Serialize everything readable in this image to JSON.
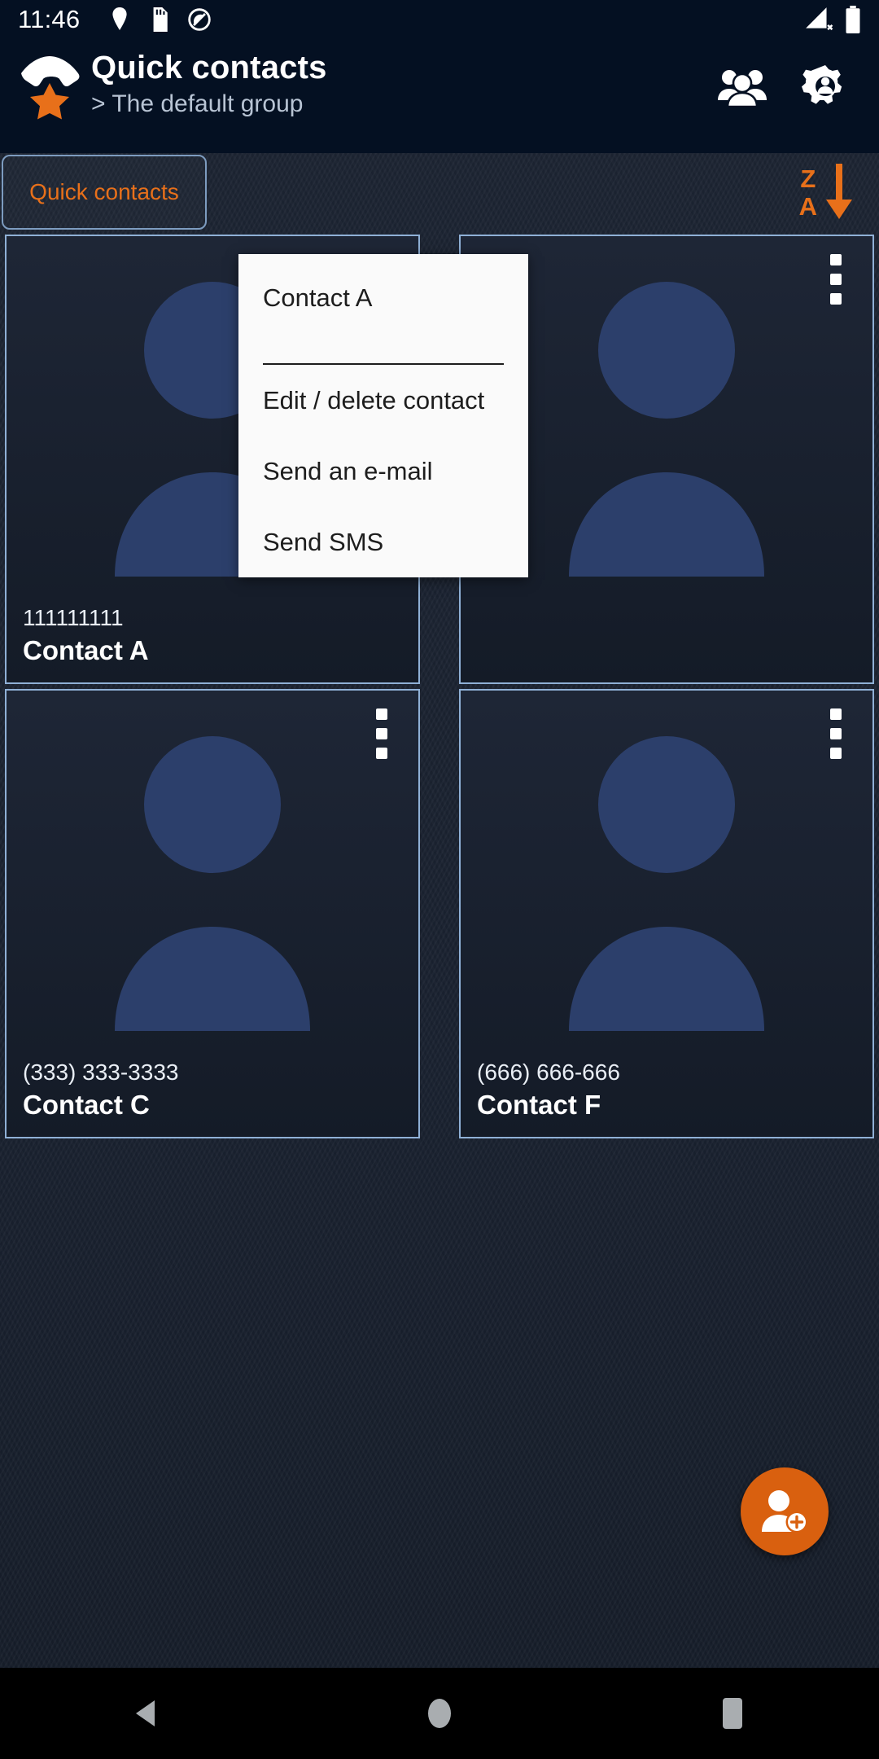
{
  "statusbar": {
    "clock": "11:46",
    "icons": [
      "location-pin-icon",
      "sd-card-icon",
      "do-not-disturb-icon"
    ],
    "right_icons": [
      "signal-no-service-icon",
      "battery-full-icon"
    ]
  },
  "appbar": {
    "logo": "phone-star-icon",
    "title": "Quick contacts",
    "subtitle": "> The default group",
    "actions": [
      {
        "name": "group-icon",
        "label": "Groups"
      },
      {
        "name": "gear-icon",
        "label": "Settings"
      }
    ]
  },
  "tabs": {
    "items": [
      {
        "label": "Quick contacts",
        "selected": true
      }
    ],
    "sort": {
      "top_letter": "Z",
      "bottom_letter": "A",
      "direction": "descending",
      "icon": "sort-arrow-down-icon"
    }
  },
  "contacts": [
    {
      "phone": "111111111",
      "name": "Contact A",
      "avatar": "person-placeholder-icon",
      "menu_icon": "kebab-menu-icon"
    },
    {
      "phone": "",
      "name": "",
      "avatar": "person-placeholder-icon",
      "menu_icon": "kebab-menu-icon"
    },
    {
      "phone": "(333) 333-3333",
      "name": "Contact C",
      "avatar": "person-placeholder-icon",
      "menu_icon": "kebab-menu-icon"
    },
    {
      "phone": "(666) 666-666",
      "name": "Contact F",
      "avatar": "person-placeholder-icon",
      "menu_icon": "kebab-menu-icon"
    }
  ],
  "popup": {
    "header": "Contact A",
    "items": [
      {
        "label": "Edit / delete contact"
      },
      {
        "label": "Send an e-mail"
      },
      {
        "label": "Send SMS"
      }
    ]
  },
  "fab": {
    "icon": "add-person-icon",
    "color": "#d9600f"
  },
  "navbar": {
    "buttons": [
      {
        "name": "back-button",
        "icon": "triangle-left-icon"
      },
      {
        "name": "home-button",
        "icon": "circle-icon"
      },
      {
        "name": "recents-button",
        "icon": "square-icon"
      }
    ]
  },
  "colors": {
    "accent": "#e8701a",
    "appbar_bg": "#041022",
    "card_border": "#8fb0d6",
    "popup_bg": "#fafafa"
  }
}
